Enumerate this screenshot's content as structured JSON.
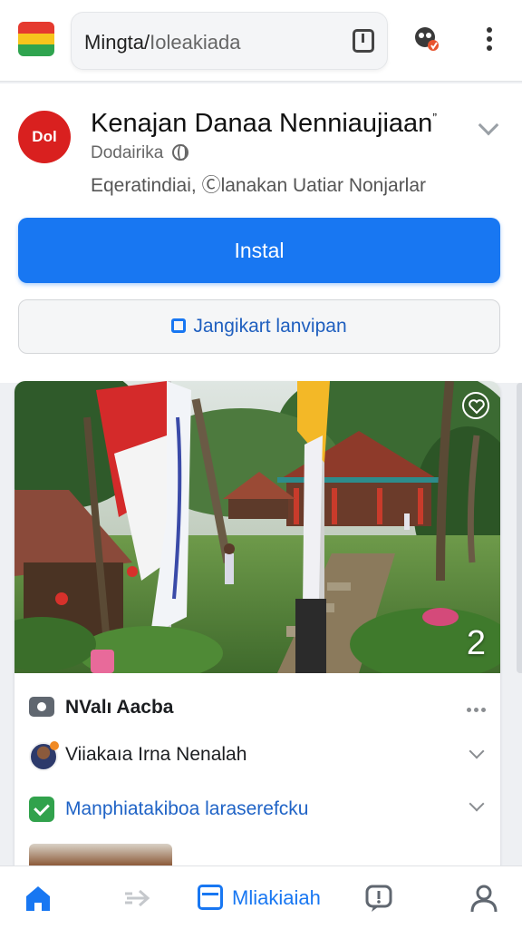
{
  "browser": {
    "url_domain": "Mingta/",
    "url_path": "Ioleakiada",
    "tab_icon": "tab-switcher-icon",
    "extension_icon": "extension-icon",
    "menu_icon": "more-vertical-icon"
  },
  "app": {
    "logo_text": "Dol",
    "title": "Kenajan Danaa Nenniaujiaan",
    "title_mark": "”",
    "developer": "Dodairika",
    "subtitle": "Eqeratindiai, Ⓒlanakan Uatiar Nonjarlar",
    "install_label": "Instal",
    "secondary_label": "Jangikart lanvipan",
    "colors": {
      "install": "#1877f2",
      "logo": "#d9201f"
    }
  },
  "photo": {
    "count": "2",
    "favorite_icon": "heart-icon"
  },
  "rows": [
    {
      "type": "header",
      "icon": "camera-icon",
      "text": "NValı Aacba"
    },
    {
      "type": "author",
      "icon": "avatar",
      "text": "Viiakaıa Irna Nenalah"
    },
    {
      "type": "link",
      "icon": "check-icon",
      "text": "Manphiatakiboa laraserefcku"
    }
  ],
  "nav": {
    "active_label": "Mliakiaiah",
    "items": [
      "home-icon",
      "forward-icon",
      "tab-active",
      "notification-icon",
      "profile-icon"
    ]
  }
}
